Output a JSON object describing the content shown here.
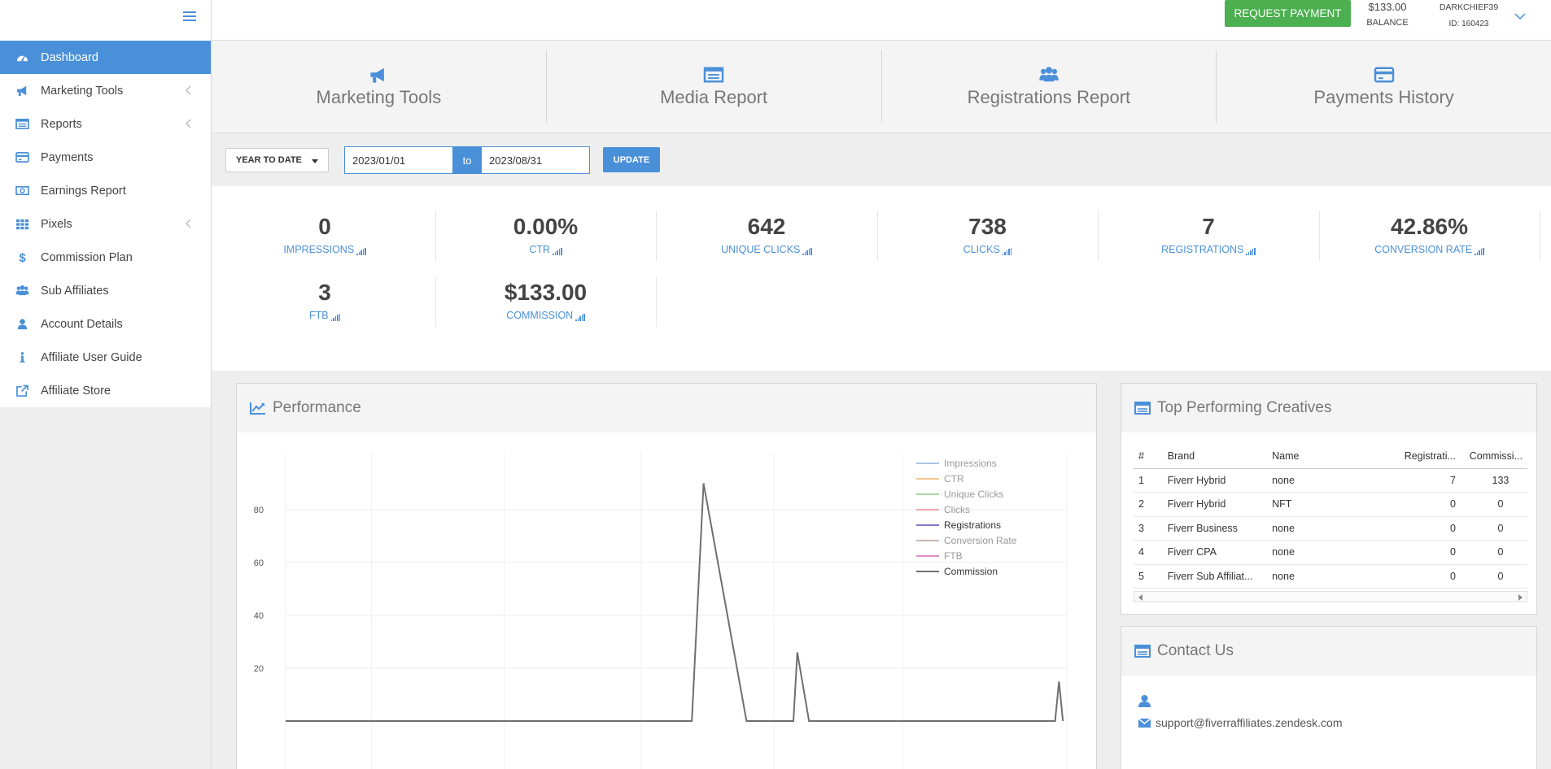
{
  "sidebar": {
    "items": [
      {
        "label": "Dashboard",
        "icon": "dashboard-icon",
        "active": true,
        "chevron": false
      },
      {
        "label": "Marketing Tools",
        "icon": "megaphone-icon",
        "active": false,
        "chevron": true
      },
      {
        "label": "Reports",
        "icon": "report-list-icon",
        "active": false,
        "chevron": true
      },
      {
        "label": "Payments",
        "icon": "credit-card-icon",
        "active": false,
        "chevron": false
      },
      {
        "label": "Earnings Report",
        "icon": "money-icon",
        "active": false,
        "chevron": false
      },
      {
        "label": "Pixels",
        "icon": "grid-icon",
        "active": false,
        "chevron": true
      },
      {
        "label": "Commission Plan",
        "icon": "dollar-icon",
        "active": false,
        "chevron": false
      },
      {
        "label": "Sub Affiliates",
        "icon": "users-icon",
        "active": false,
        "chevron": false
      },
      {
        "label": "Account Details",
        "icon": "user-icon",
        "active": false,
        "chevron": false
      },
      {
        "label": "Affiliate User Guide",
        "icon": "info-icon",
        "active": false,
        "chevron": false
      },
      {
        "label": "Affiliate Store",
        "icon": "external-link-icon",
        "active": false,
        "chevron": false
      }
    ]
  },
  "topbar": {
    "request_payment": "REQUEST PAYMENT",
    "balance_amount": "$133.00",
    "balance_label": "BALANCE",
    "username": "DARKCHIEF39",
    "user_id": "ID: 160423"
  },
  "quicklinks": [
    {
      "title": "Marketing Tools",
      "icon": "megaphone-icon"
    },
    {
      "title": "Media Report",
      "icon": "report-list-icon"
    },
    {
      "title": "Registrations Report",
      "icon": "users-icon"
    },
    {
      "title": "Payments History",
      "icon": "credit-card-icon"
    }
  ],
  "filter": {
    "range": "YEAR TO DATE",
    "from": "2023/01/01",
    "to_label": "to",
    "to": "2023/08/31",
    "update": "UPDATE"
  },
  "stats": [
    {
      "value": "0",
      "label": "IMPRESSIONS"
    },
    {
      "value": "0.00%",
      "label": "CTR"
    },
    {
      "value": "642",
      "label": "UNIQUE CLICKS"
    },
    {
      "value": "738",
      "label": "CLICKS"
    },
    {
      "value": "7",
      "label": "REGISTRATIONS"
    },
    {
      "value": "42.86%",
      "label": "CONVERSION RATE"
    },
    {
      "value": "3",
      "label": "FTB"
    },
    {
      "value": "$133.00",
      "label": "COMMISSION"
    }
  ],
  "performance": {
    "title": "Performance"
  },
  "chart_data": {
    "type": "line",
    "title": "",
    "xlabel": "",
    "ylabel": "",
    "yticks": [
      20,
      40,
      60,
      80
    ],
    "ylim": [
      0,
      100
    ],
    "grid": true,
    "legend_position": "top-right",
    "series": [
      {
        "name": "Impressions",
        "color": "#a9c5e6",
        "values": []
      },
      {
        "name": "CTR",
        "color": "#f4c48e",
        "values": []
      },
      {
        "name": "Unique Clicks",
        "color": "#a6d8a2",
        "values": []
      },
      {
        "name": "Clicks",
        "color": "#f2a6a8",
        "values": []
      },
      {
        "name": "Registrations",
        "color": "#8a75c9",
        "values": []
      },
      {
        "name": "Conversion Rate",
        "color": "#c8b4ae",
        "values": []
      },
      {
        "name": "FTB",
        "color": "#e28fc8",
        "values": []
      },
      {
        "name": "Commission",
        "color": "#6f6f6f",
        "values": [
          {
            "x": 0.0,
            "y": 0
          },
          {
            "x": 0.3,
            "y": 0
          },
          {
            "x": 0.52,
            "y": 0
          },
          {
            "x": 0.535,
            "y": 90
          },
          {
            "x": 0.59,
            "y": 0
          },
          {
            "x": 0.65,
            "y": 0
          },
          {
            "x": 0.655,
            "y": 26
          },
          {
            "x": 0.67,
            "y": 0
          },
          {
            "x": 0.985,
            "y": 0
          },
          {
            "x": 0.99,
            "y": 15
          },
          {
            "x": 0.995,
            "y": 0
          }
        ]
      }
    ]
  },
  "top_creatives": {
    "title": "Top Performing Creatives",
    "columns": [
      "#",
      "Brand",
      "Name",
      "Registrati...",
      "Commissi..."
    ],
    "rows": [
      [
        "1",
        "Fiverr Hybrid",
        "none",
        "7",
        "133"
      ],
      [
        "2",
        "Fiverr Hybrid",
        "NFT",
        "0",
        "0"
      ],
      [
        "3",
        "Fiverr Business",
        "none",
        "0",
        "0"
      ],
      [
        "4",
        "Fiverr CPA",
        "none",
        "0",
        "0"
      ],
      [
        "5",
        "Fiverr Sub Affiliat...",
        "none",
        "0",
        "0"
      ]
    ]
  },
  "contact": {
    "title": "Contact Us",
    "email": "support@fiverraffiliates.zendesk.com"
  },
  "colors": {
    "accent": "#4a90d9",
    "success": "#4caf50"
  }
}
